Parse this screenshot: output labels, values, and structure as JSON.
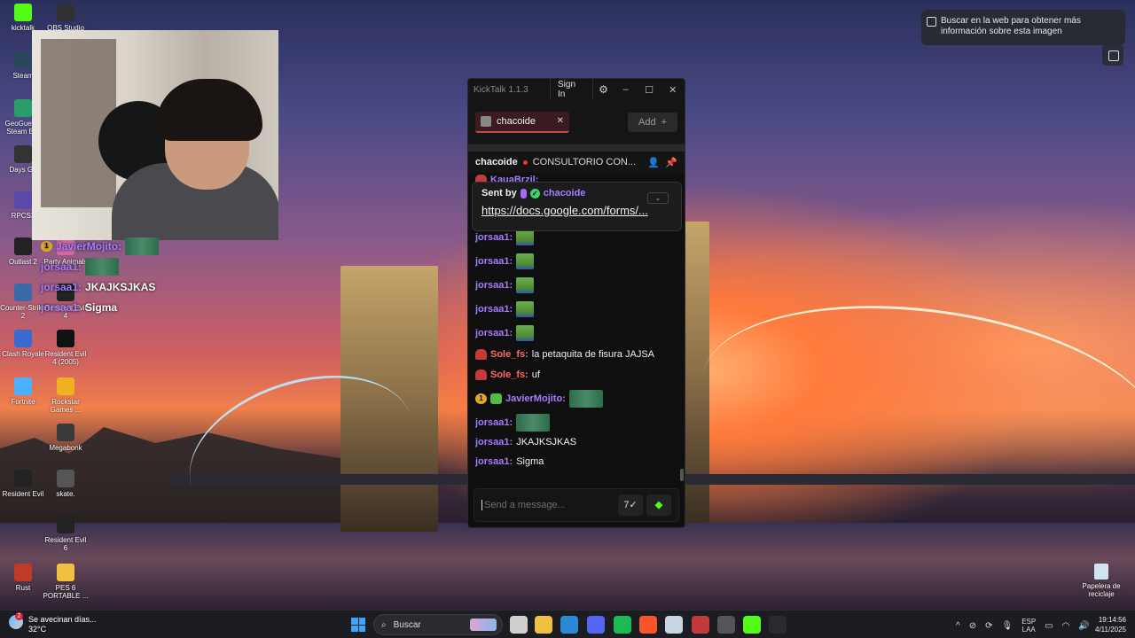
{
  "desktop": {
    "icons_left": [
      {
        "label": "kicktalk",
        "color": "#53fc18"
      },
      {
        "label": "OBS Studio",
        "color": "#303035"
      },
      {
        "label": "Steam",
        "color": "#2a475e"
      },
      {
        "label": "GeoGuessr Steam E...",
        "color": "#2a9d6a"
      },
      {
        "label": "Days Go",
        "color": "#333"
      },
      {
        "label": "RPCS3",
        "color": "#5a4aa8"
      },
      {
        "label": "Outlast 2",
        "color": "#222"
      },
      {
        "label": "Party Animals",
        "color": "#d06aa0"
      },
      {
        "label": "Counter-Strike 2",
        "color": "#3a6aa8"
      },
      {
        "label": "Resident Evil 4",
        "color": "#222"
      },
      {
        "label": "Clash Royale",
        "color": "#3a6ad0"
      },
      {
        "label": "Resident Evil 4 (2005)",
        "color": "#111"
      },
      {
        "label": "Fortnite",
        "color": "#4ab0ff"
      },
      {
        "label": "Rockstar Games ...",
        "color": "#f0b020"
      },
      {
        "label": "Megabonk",
        "color": "#3a3a3a"
      },
      {
        "label": "Resident Evil",
        "color": "#222"
      },
      {
        "label": "skate.",
        "color": "#555"
      },
      {
        "label": "Resident Evil 6",
        "color": "#222"
      },
      {
        "label": "Rust",
        "color": "#c03a2a"
      },
      {
        "label": "PES 6 PORTABLE ...",
        "color": "#f0c040"
      }
    ],
    "recycle_bin": "Papelera de reciclaje"
  },
  "overlay_chat": [
    {
      "user": "JavierMojito:",
      "text": ""
    },
    {
      "user": "jorsaa1:",
      "text": ""
    },
    {
      "user": "jorsaa1:",
      "text": "JKAJKSJKAS"
    },
    {
      "user": "jorsaa1:",
      "text": "Sigma"
    }
  ],
  "lens_tooltip": "Buscar en la web para obtener más información sobre esta imagen",
  "kicktalk": {
    "title": "KickTalk 1.1.3",
    "signin": "Sign In",
    "tab_channel": "chacoide",
    "add_label": "Add",
    "stream_channel": "chacoide",
    "stream_title": "CONSULTORIO CON...",
    "pinned": {
      "sent_by": "Sent by",
      "user": "chacoide",
      "link": "https://docs.google.com/forms/..."
    },
    "partial_user": "KauaBrzil:",
    "messages": [
      {
        "user": "jorsaa1:",
        "color": "#a67cff",
        "text": "",
        "emote": "pepe",
        "badge": ""
      },
      {
        "user": "jorsaa1:",
        "color": "#a67cff",
        "text": "",
        "emote": "pepe",
        "badge": ""
      },
      {
        "user": "jorsaa1:",
        "color": "#a67cff",
        "text": "",
        "emote": "pepe",
        "badge": ""
      },
      {
        "user": "jorsaa1:",
        "color": "#a67cff",
        "text": "",
        "emote": "pepe",
        "badge": ""
      },
      {
        "user": "jorsaa1:",
        "color": "#a67cff",
        "text": "",
        "emote": "pepe",
        "badge": ""
      },
      {
        "user": "Sole_fs:",
        "color": "#ff6b6b",
        "text": "la petaquita de fisura JAJSA",
        "emote": "",
        "badge": "red"
      },
      {
        "user": "Sole_fs:",
        "color": "#ff6b6b",
        "text": "uf",
        "emote": "",
        "badge": "red"
      },
      {
        "user": "JavierMojito:",
        "color": "#a67cff",
        "text": "",
        "emote": "group",
        "badge": "gold"
      },
      {
        "user": "jorsaa1:",
        "color": "#a67cff",
        "text": "",
        "emote": "group",
        "badge": ""
      },
      {
        "user": "jorsaa1:",
        "color": "#a67cff",
        "text": "JKAJKSJKAS",
        "emote": "",
        "badge": ""
      },
      {
        "user": "jorsaa1:",
        "color": "#a67cff",
        "text": "Sigma",
        "emote": "",
        "badge": ""
      }
    ],
    "input_placeholder": "Send a message..."
  },
  "taskbar": {
    "weather_text": "Se avecinan días...",
    "weather_temp": "32°C",
    "weather_badge": "2",
    "search_label": "Buscar",
    "lang_top": "ESP",
    "lang_bottom": "LAA",
    "time": "19:14:56",
    "date": "4/11/2025",
    "apps": [
      {
        "name": "task-view",
        "color": "#cfcfcf"
      },
      {
        "name": "file-explorer",
        "color": "#f0c040"
      },
      {
        "name": "bing",
        "color": "#2a8ad6"
      },
      {
        "name": "discord",
        "color": "#5865f2"
      },
      {
        "name": "spotify",
        "color": "#1db954"
      },
      {
        "name": "brave",
        "color": "#fb542b"
      },
      {
        "name": "steam",
        "color": "#c7d5e0"
      },
      {
        "name": "voicemeeter",
        "color": "#c23a3a"
      },
      {
        "name": "obs",
        "color": "#555"
      },
      {
        "name": "kicktalk",
        "color": "#53fc18"
      },
      {
        "name": "epic-games",
        "color": "#2a2a2a"
      }
    ]
  }
}
